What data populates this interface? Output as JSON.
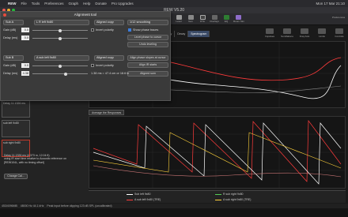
{
  "menubar": {
    "app": "REW",
    "items": [
      "File",
      "Tools",
      "Preferences",
      "Graph",
      "Help",
      "Donate",
      "Pro Upgrades"
    ],
    "clock": "Mon 17 Mar 21:10"
  },
  "window_title": "REW V5.20",
  "toolbar": {
    "buttons": [
      "Meas",
      "Import",
      "Scope",
      "Level",
      "Gen",
      "RTA",
      "Overlays",
      "EQ",
      "Room Sim"
    ]
  },
  "right_tools": {
    "items": [
      "Impulses",
      "Sumflations",
      "Freq Axis",
      "Limits",
      "Controls"
    ],
    "preferences": "Preferences"
  },
  "graph_tabs": {
    "items": [
      "RTA Decay",
      "Clarity",
      "Decay",
      "Spectrogram"
    ]
  },
  "align_tool": {
    "title": "Alignment tool",
    "row1": {
      "selector": "Sub A",
      "meas": "L R left 9x80",
      "action": "Aligned copy",
      "gain_label": "Gain (dB)",
      "gain_value": "0.0",
      "delay_label": "Delay (ms)",
      "delay_value": "0.0",
      "invert_label": "Invert polarity"
    },
    "smoothing": "1/12 smoothing",
    "show_phase": "Show phase traces",
    "level_phase": "Level phase to cursor",
    "undo": "Undo leveling",
    "row2": {
      "selector": "Sub B",
      "meas": "A sub left 9x80",
      "action": "Aligned copy",
      "gain_label": "Gain (dB)",
      "gain_value": "0.0",
      "delay_label": "Delay (ms)",
      "delay_value": "4.38",
      "invert_label": "Invert polarity"
    },
    "align_phase": "Align phase slopes at cursor",
    "align_ir": "Align IR starts",
    "aligned_sum": "Aligned sum",
    "delay_note": "1.38 ms = 47.4 cm or 18.6 in"
  },
  "measurements": [
    {
      "name": "Delay 11.1326 ms",
      "info": ""
    },
    {
      "name": "sub left 9x80",
      "info": ""
    },
    {
      "name": "sub right 9x80",
      "info": ""
    }
  ],
  "detail": [
    "Delay 11.1326 ms (4.373 m, 12.04 ft)",
    "using IR start time relative to Acoustic reference on",
    "[REW104L, with no timing offset]"
  ],
  "change_cal": "Change Cal...",
  "avg_button": "Average the Responses",
  "legend": [
    {
      "label": "Sub left 9x80",
      "color": "#ffffff"
    },
    {
      "label": "R sub right 9x80",
      "color": "#55cc55"
    },
    {
      "label": "A sub left 9x80 (TRE)",
      "color": "#ff3b3b"
    },
    {
      "label": "A sub right 9x80 (TRE)",
      "color": "#ffd23b"
    }
  ],
  "status": "Peak input before clipping 123 dB SPL (uncalibrated)",
  "status_left": "453/4096MB",
  "status_mid": "48000 Hz   44.1 kHz"
}
